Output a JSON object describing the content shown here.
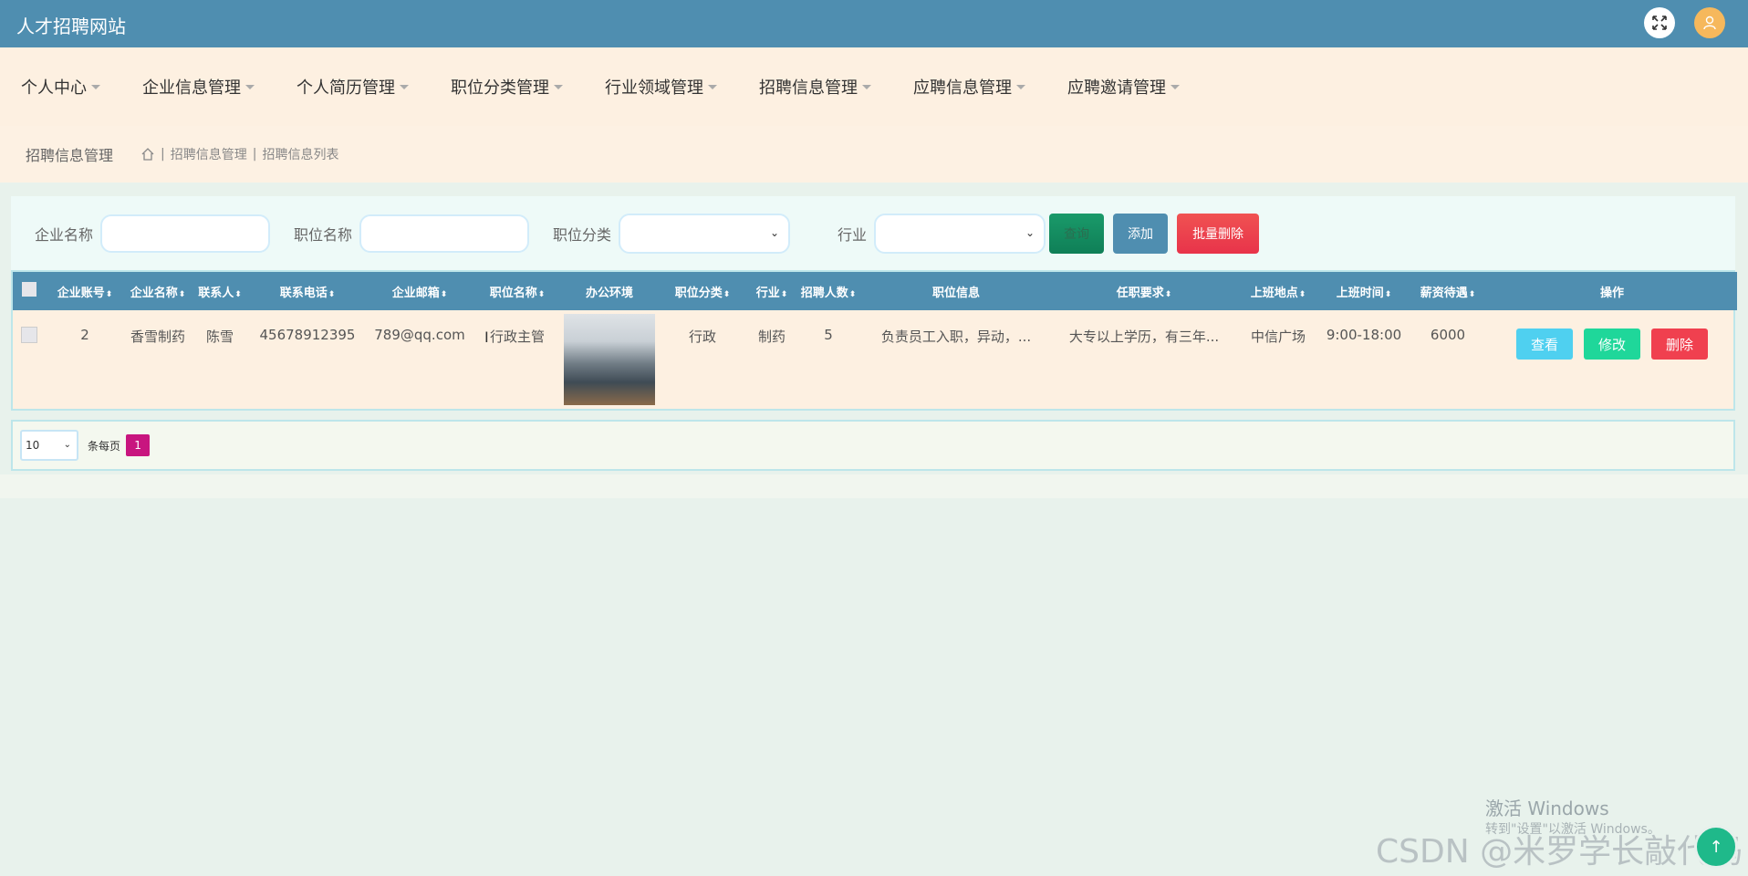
{
  "app": {
    "title": "人才招聘网站"
  },
  "nav": {
    "items": [
      {
        "label": "个人中心"
      },
      {
        "label": "企业信息管理"
      },
      {
        "label": "个人简历管理"
      },
      {
        "label": "职位分类管理"
      },
      {
        "label": "行业领域管理"
      },
      {
        "label": "招聘信息管理"
      },
      {
        "label": "应聘信息管理"
      },
      {
        "label": "应聘邀请管理"
      }
    ]
  },
  "breadcrumb": {
    "title": "招聘信息管理",
    "path": [
      "招聘信息管理",
      "招聘信息列表"
    ]
  },
  "filter": {
    "company_label": "企业名称",
    "company_value": "",
    "position_label": "职位名称",
    "position_value": "",
    "category_label": "职位分类",
    "category_value": "",
    "industry_label": "行业",
    "industry_value": "",
    "search_label": "查询",
    "add_label": "添加",
    "batch_delete_label": "批量删除"
  },
  "table": {
    "headers": [
      "企业账号",
      "企业名称",
      "联系人",
      "联系电话",
      "企业邮箱",
      "职位名称",
      "办公环境",
      "职位分类",
      "行业",
      "招聘人数",
      "职位信息",
      "任职要求",
      "上班地点",
      "上班时间",
      "薪资待遇",
      "操作"
    ],
    "rows": [
      {
        "account": "2",
        "company": "香雪制药",
        "contact": "陈雪",
        "phone": "45678912395",
        "email": "789@qq.com",
        "position": "行政主管",
        "category": "行政",
        "industry": "制药",
        "count": "5",
        "info": "负责员工入职，异动，...",
        "requirement": "大专以上学历，有三年...",
        "location": "中信广场",
        "hours": "9:00-18:00",
        "salary": "6000"
      }
    ],
    "actions": {
      "view": "查看",
      "edit": "修改",
      "delete": "删除"
    }
  },
  "pager": {
    "page_size": "10",
    "per_page_label": "条每页",
    "current_page": "1"
  },
  "watermark": {
    "activate": "激活 Windows",
    "activate_hint": "转到\"设置\"以激活 Windows。",
    "csdn": "CSDN @米罗学长敲代码"
  },
  "colors": {
    "primary": "#4f8eb0",
    "nav_bg": "#fdf0e1",
    "delete": "#f0404f",
    "edit": "#1fd79a",
    "view": "#4fd0f0",
    "page_active": "#c8157f"
  }
}
